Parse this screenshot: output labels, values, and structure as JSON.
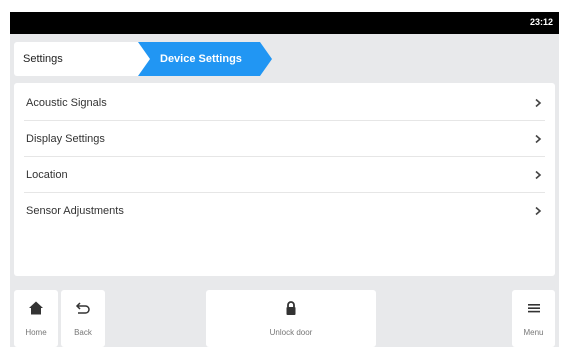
{
  "status_bar": {
    "time": "23:12"
  },
  "breadcrumb": {
    "root": "Settings",
    "current": "Device Settings"
  },
  "menu_items": [
    {
      "label": "Acoustic Signals"
    },
    {
      "label": "Display Settings"
    },
    {
      "label": "Location"
    },
    {
      "label": "Sensor Adjustments"
    }
  ],
  "bottom_bar": {
    "home": "Home",
    "back": "Back",
    "unlock": "Unlock door",
    "menu": "Menu"
  },
  "colors": {
    "accent": "#2196f3",
    "background": "#e8e9eb",
    "status_bar": "#000000"
  }
}
